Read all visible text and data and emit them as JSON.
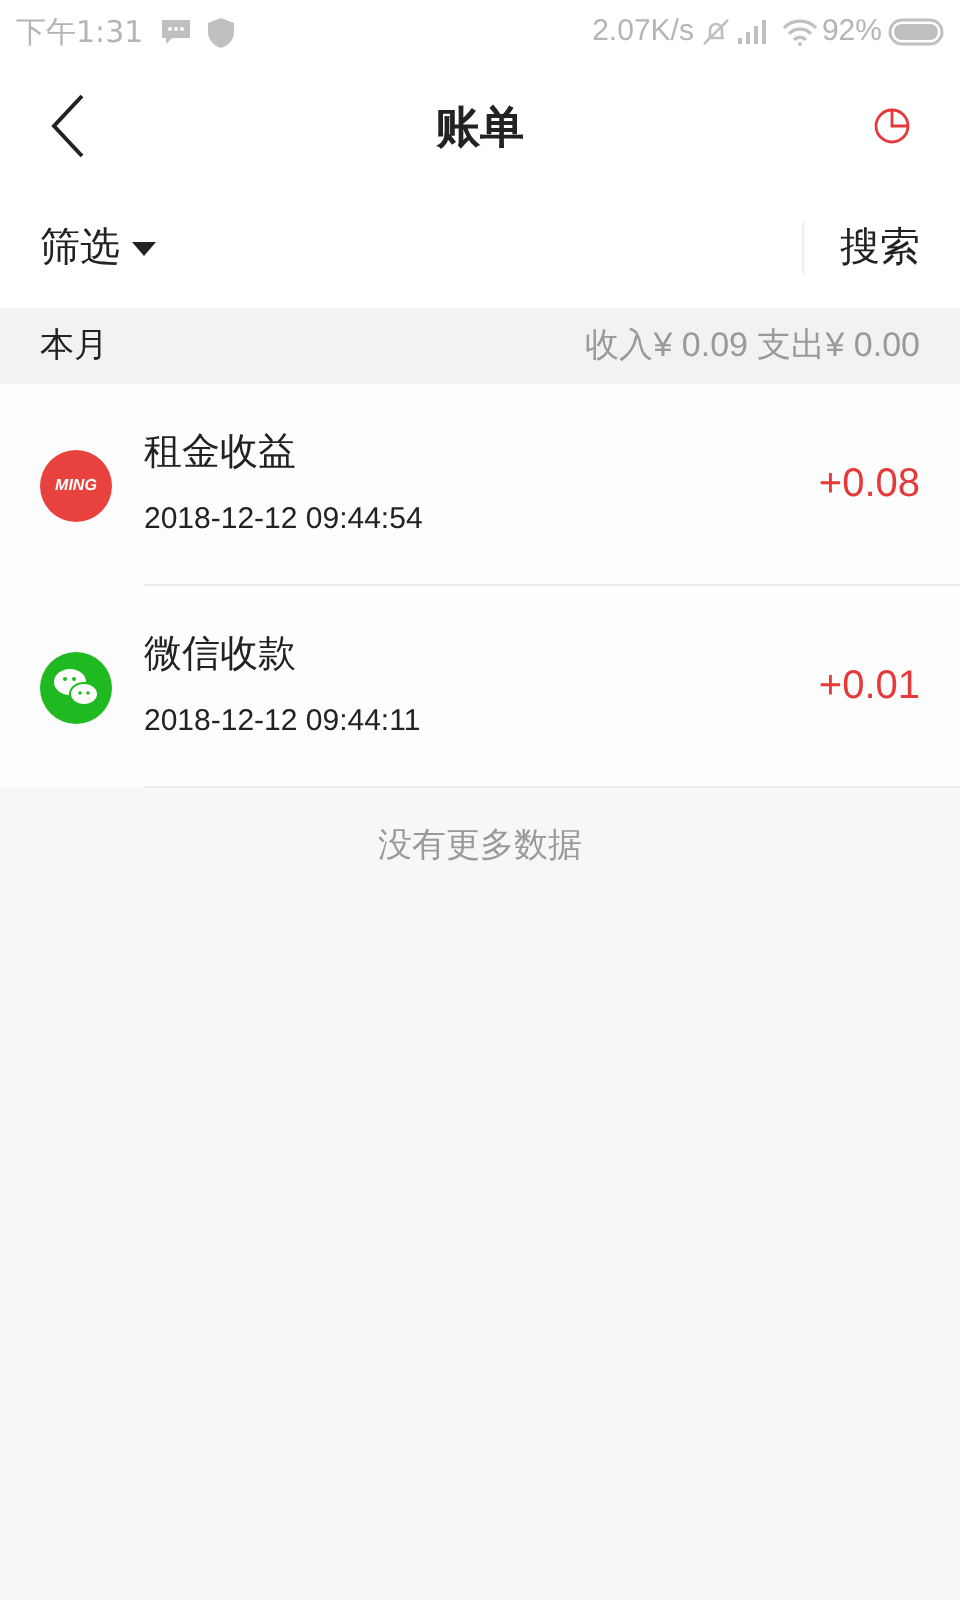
{
  "status_bar": {
    "time": "下午1:31",
    "speed": "2.07K/s",
    "battery": "92%"
  },
  "header": {
    "title": "账单"
  },
  "toolbar": {
    "filter": "筛选",
    "search": "搜索"
  },
  "month": {
    "label": "本月",
    "summary": "收入¥ 0.09 支出¥ 0.00"
  },
  "transactions": [
    {
      "kind": "ming",
      "icon_text": "MING",
      "title": "租金收益",
      "time": "2018-12-12 09:44:54",
      "amount": "+0.08"
    },
    {
      "kind": "wechat",
      "title": "微信收款",
      "time": "2018-12-12 09:44:11",
      "amount": "+0.01"
    }
  ],
  "footer": "没有更多数据"
}
